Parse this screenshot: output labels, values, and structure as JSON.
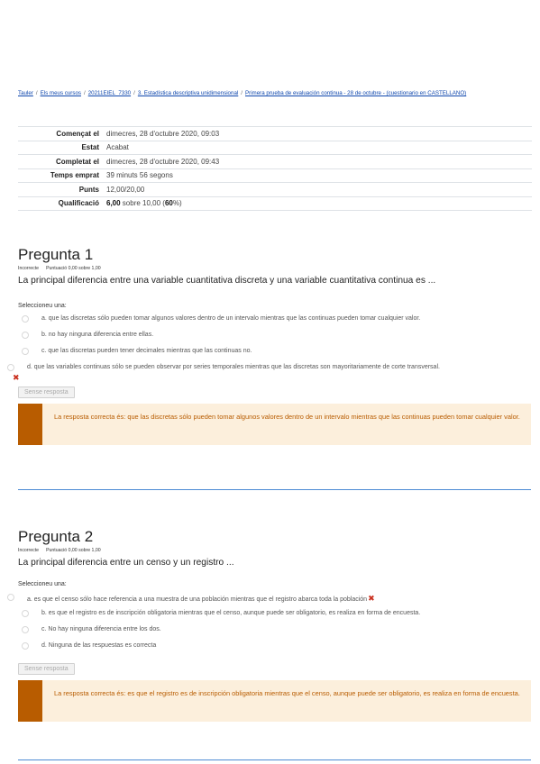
{
  "breadcrumb": [
    "Tauler",
    "Els meus cursos",
    "20211EIEL_7330",
    "3. Estadística descriptiva unidimensional",
    "Primera prueba de evaluación continua - 28 de octubre - (cuestionario en CASTELLANO)"
  ],
  "summary": {
    "rows": [
      {
        "key": "Començat el",
        "value": "dimecres, 28 d'octubre 2020, 09:03"
      },
      {
        "key": "Estat",
        "value": "Acabat"
      },
      {
        "key": "Completat el",
        "value": "dimecres, 28 d'octubre 2020, 09:43"
      },
      {
        "key": "Temps emprat",
        "value": "39 minuts 56 segons"
      },
      {
        "key": "Punts",
        "value": "12,00/20,00"
      }
    ],
    "grade": {
      "key": "Qualificació",
      "score": "6,00",
      "mid": " sobre 10,00 (",
      "percent": "60",
      "end": "%)"
    }
  },
  "questions": [
    {
      "title": "Pregunta 1",
      "state": "Incorrecte",
      "mark": "Puntuació 0,00 sobre 1,00",
      "text": "La principal diferencia entre una variable cuantitativa discreta y una variable cuantitativa continua es ...",
      "prompt": "Seleccioneu una:",
      "answers": [
        "a. que las discretas sólo pueden tomar algunos valores dentro de un intervalo mientras que las continuas pueden tomar cualquier valor.",
        "b. no hay ninguna diferencia entre ellas.",
        "c. que las discretas pueden tener decimales mientras que las continuas no.",
        "d. que las variables continuas sólo se pueden observar por series temporales mientras que las discretas son mayoritariamente de corte transversal."
      ],
      "button": "Sense resposta",
      "feedback": "La resposta correcta és: que las discretas sólo pueden tomar algunos valores dentro de un intervalo mientras que las continuas pueden tomar cualquier valor."
    },
    {
      "title": "Pregunta 2",
      "state": "Incorrecte",
      "mark": "Puntuació 0,00 sobre 1,00",
      "text": "La principal diferencia entre un censo y un registro ...",
      "prompt": "Seleccioneu una:",
      "answers": [
        "a. es que el censo sólo hace referencia a una muestra de una población mientras que el registro abarca toda la población",
        "b. es que el registro es de inscripción obligatoria mientras que el censo, aunque puede ser obligatorio, es realiza en forma de encuesta.",
        "c. No hay ninguna diferencia entre los dos.",
        "d. Ninguna de las respuestas es correcta"
      ],
      "button": "Sense resposta",
      "feedback": "La resposta correcta és: es que el registro es de inscripción obligatoria mientras que el censo, aunque puede ser obligatorio, es realiza en forma de encuesta."
    }
  ],
  "icons": {
    "cross": "✖"
  },
  "colors": {
    "link": "#0f47ad",
    "feedback_bg": "#fcefdc",
    "feedback_text": "#b85c00",
    "incorrect": "#ca3120",
    "divider": "#4d8bd4"
  }
}
